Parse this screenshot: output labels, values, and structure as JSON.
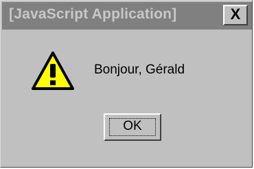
{
  "dialog": {
    "title": "[JavaScript Application]",
    "close_label": "X",
    "message": "Bonjour, Gérald",
    "ok_label": "OK",
    "icon": "warning-icon"
  },
  "colors": {
    "dialog_bg": "#c0c0c0",
    "titlebar_bg": "#808080",
    "title_text": "#c8c8c8",
    "icon_fill": "#ffff00"
  }
}
